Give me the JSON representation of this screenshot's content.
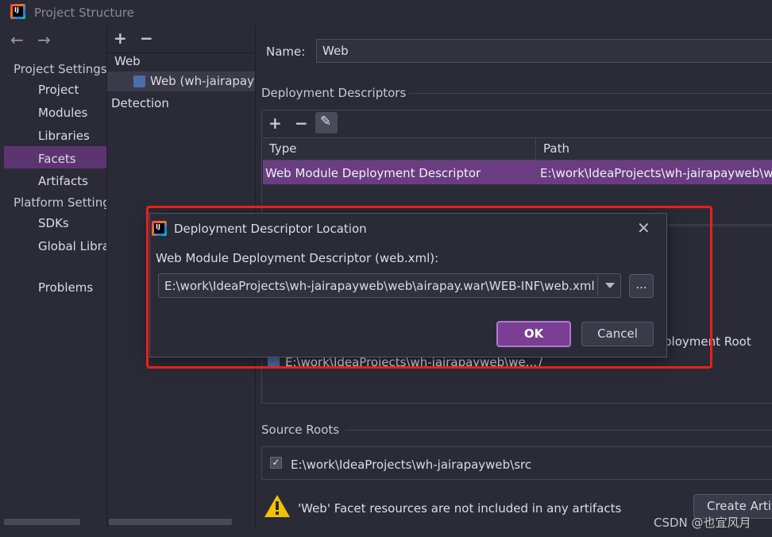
{
  "window": {
    "title": "Project Structure"
  },
  "nav": {
    "back_arrow": "←",
    "forward_arrow": "→",
    "sections": [
      {
        "label": "Project Settings",
        "items": [
          "Project",
          "Modules",
          "Libraries",
          "Facets",
          "Artifacts"
        ]
      },
      {
        "label": "Platform Settings",
        "items": [
          "SDKs",
          "Global Libraries"
        ]
      }
    ],
    "problems": "Problems",
    "selected": "Facets"
  },
  "facets": {
    "add": "+",
    "remove": "−",
    "group_label": "Web",
    "item_label": "Web (wh-jairapayweb)",
    "detection": "Detection"
  },
  "main": {
    "name_label": "Name:",
    "name_value": "Web",
    "descriptors_heading": "Deployment Descriptors",
    "descriptors_table": {
      "toolbar": {
        "add": "+",
        "remove": "−",
        "edit": "✎"
      },
      "columns": [
        "Type",
        "Path"
      ],
      "rows": [
        {
          "type": "Web Module Deployment Descriptor",
          "path": "E:\\work\\IdeaProjects\\wh-jairapayweb\\web\\airapay.war\\WEB-INF\\web.xml"
        }
      ]
    },
    "web_resources": {
      "partial_column": "ployment Root",
      "row_dir": "E:\\work\\IdeaProjects\\wh-jairapayweb\\we...",
      "row_root": "/"
    },
    "source_roots_heading": "Source Roots",
    "source_root": "E:\\work\\IdeaProjects\\wh-jairapayweb\\src",
    "source_root_checked": true,
    "warning_text": "'Web' Facet resources are not included in any artifacts",
    "create_artifact_label": "Create Artifact"
  },
  "dialog": {
    "title": "Deployment Descriptor Location",
    "close": "✕",
    "field_label": "Web Module Deployment Descriptor (web.xml):",
    "path_value": "E:\\work\\IdeaProjects\\wh-jairapayweb\\web\\airapay.war\\WEB-INF\\web.xml",
    "browse_label": "...",
    "ok_label": "OK",
    "cancel_label": "Cancel"
  },
  "watermark": "CSDN @也宜风月",
  "colors": {
    "background": "#2b2b38",
    "selection": "#5c3570",
    "row_selection": "#6a3d82",
    "ok_button": "#7a3e94",
    "highlight_frame": "#e8201a"
  }
}
